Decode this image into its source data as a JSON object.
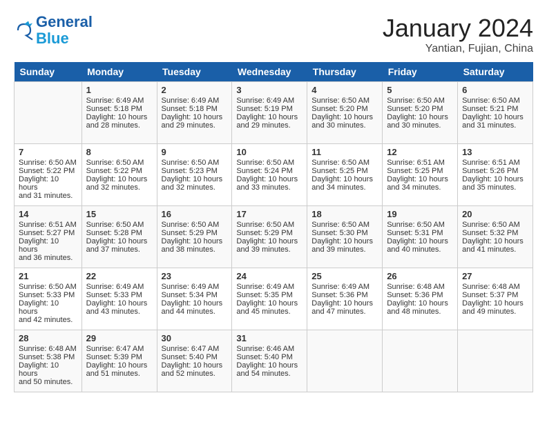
{
  "header": {
    "logo_line1": "General",
    "logo_line2": "Blue",
    "month_year": "January 2024",
    "location": "Yantian, Fujian, China"
  },
  "weekdays": [
    "Sunday",
    "Monday",
    "Tuesday",
    "Wednesday",
    "Thursday",
    "Friday",
    "Saturday"
  ],
  "weeks": [
    [
      {
        "day": "",
        "info": ""
      },
      {
        "day": "1",
        "info": "Sunrise: 6:49 AM\nSunset: 5:18 PM\nDaylight: 10 hours\nand 28 minutes."
      },
      {
        "day": "2",
        "info": "Sunrise: 6:49 AM\nSunset: 5:18 PM\nDaylight: 10 hours\nand 29 minutes."
      },
      {
        "day": "3",
        "info": "Sunrise: 6:49 AM\nSunset: 5:19 PM\nDaylight: 10 hours\nand 29 minutes."
      },
      {
        "day": "4",
        "info": "Sunrise: 6:50 AM\nSunset: 5:20 PM\nDaylight: 10 hours\nand 30 minutes."
      },
      {
        "day": "5",
        "info": "Sunrise: 6:50 AM\nSunset: 5:20 PM\nDaylight: 10 hours\nand 30 minutes."
      },
      {
        "day": "6",
        "info": "Sunrise: 6:50 AM\nSunset: 5:21 PM\nDaylight: 10 hours\nand 31 minutes."
      }
    ],
    [
      {
        "day": "7",
        "info": "Sunrise: 6:50 AM\nSunset: 5:22 PM\nDaylight: 10 hours\nand 31 minutes."
      },
      {
        "day": "8",
        "info": "Sunrise: 6:50 AM\nSunset: 5:22 PM\nDaylight: 10 hours\nand 32 minutes."
      },
      {
        "day": "9",
        "info": "Sunrise: 6:50 AM\nSunset: 5:23 PM\nDaylight: 10 hours\nand 32 minutes."
      },
      {
        "day": "10",
        "info": "Sunrise: 6:50 AM\nSunset: 5:24 PM\nDaylight: 10 hours\nand 33 minutes."
      },
      {
        "day": "11",
        "info": "Sunrise: 6:50 AM\nSunset: 5:25 PM\nDaylight: 10 hours\nand 34 minutes."
      },
      {
        "day": "12",
        "info": "Sunrise: 6:51 AM\nSunset: 5:25 PM\nDaylight: 10 hours\nand 34 minutes."
      },
      {
        "day": "13",
        "info": "Sunrise: 6:51 AM\nSunset: 5:26 PM\nDaylight: 10 hours\nand 35 minutes."
      }
    ],
    [
      {
        "day": "14",
        "info": "Sunrise: 6:51 AM\nSunset: 5:27 PM\nDaylight: 10 hours\nand 36 minutes."
      },
      {
        "day": "15",
        "info": "Sunrise: 6:50 AM\nSunset: 5:28 PM\nDaylight: 10 hours\nand 37 minutes."
      },
      {
        "day": "16",
        "info": "Sunrise: 6:50 AM\nSunset: 5:29 PM\nDaylight: 10 hours\nand 38 minutes."
      },
      {
        "day": "17",
        "info": "Sunrise: 6:50 AM\nSunset: 5:29 PM\nDaylight: 10 hours\nand 39 minutes."
      },
      {
        "day": "18",
        "info": "Sunrise: 6:50 AM\nSunset: 5:30 PM\nDaylight: 10 hours\nand 39 minutes."
      },
      {
        "day": "19",
        "info": "Sunrise: 6:50 AM\nSunset: 5:31 PM\nDaylight: 10 hours\nand 40 minutes."
      },
      {
        "day": "20",
        "info": "Sunrise: 6:50 AM\nSunset: 5:32 PM\nDaylight: 10 hours\nand 41 minutes."
      }
    ],
    [
      {
        "day": "21",
        "info": "Sunrise: 6:50 AM\nSunset: 5:33 PM\nDaylight: 10 hours\nand 42 minutes."
      },
      {
        "day": "22",
        "info": "Sunrise: 6:49 AM\nSunset: 5:33 PM\nDaylight: 10 hours\nand 43 minutes."
      },
      {
        "day": "23",
        "info": "Sunrise: 6:49 AM\nSunset: 5:34 PM\nDaylight: 10 hours\nand 44 minutes."
      },
      {
        "day": "24",
        "info": "Sunrise: 6:49 AM\nSunset: 5:35 PM\nDaylight: 10 hours\nand 45 minutes."
      },
      {
        "day": "25",
        "info": "Sunrise: 6:49 AM\nSunset: 5:36 PM\nDaylight: 10 hours\nand 47 minutes."
      },
      {
        "day": "26",
        "info": "Sunrise: 6:48 AM\nSunset: 5:36 PM\nDaylight: 10 hours\nand 48 minutes."
      },
      {
        "day": "27",
        "info": "Sunrise: 6:48 AM\nSunset: 5:37 PM\nDaylight: 10 hours\nand 49 minutes."
      }
    ],
    [
      {
        "day": "28",
        "info": "Sunrise: 6:48 AM\nSunset: 5:38 PM\nDaylight: 10 hours\nand 50 minutes."
      },
      {
        "day": "29",
        "info": "Sunrise: 6:47 AM\nSunset: 5:39 PM\nDaylight: 10 hours\nand 51 minutes."
      },
      {
        "day": "30",
        "info": "Sunrise: 6:47 AM\nSunset: 5:40 PM\nDaylight: 10 hours\nand 52 minutes."
      },
      {
        "day": "31",
        "info": "Sunrise: 6:46 AM\nSunset: 5:40 PM\nDaylight: 10 hours\nand 54 minutes."
      },
      {
        "day": "",
        "info": ""
      },
      {
        "day": "",
        "info": ""
      },
      {
        "day": "",
        "info": ""
      }
    ]
  ]
}
